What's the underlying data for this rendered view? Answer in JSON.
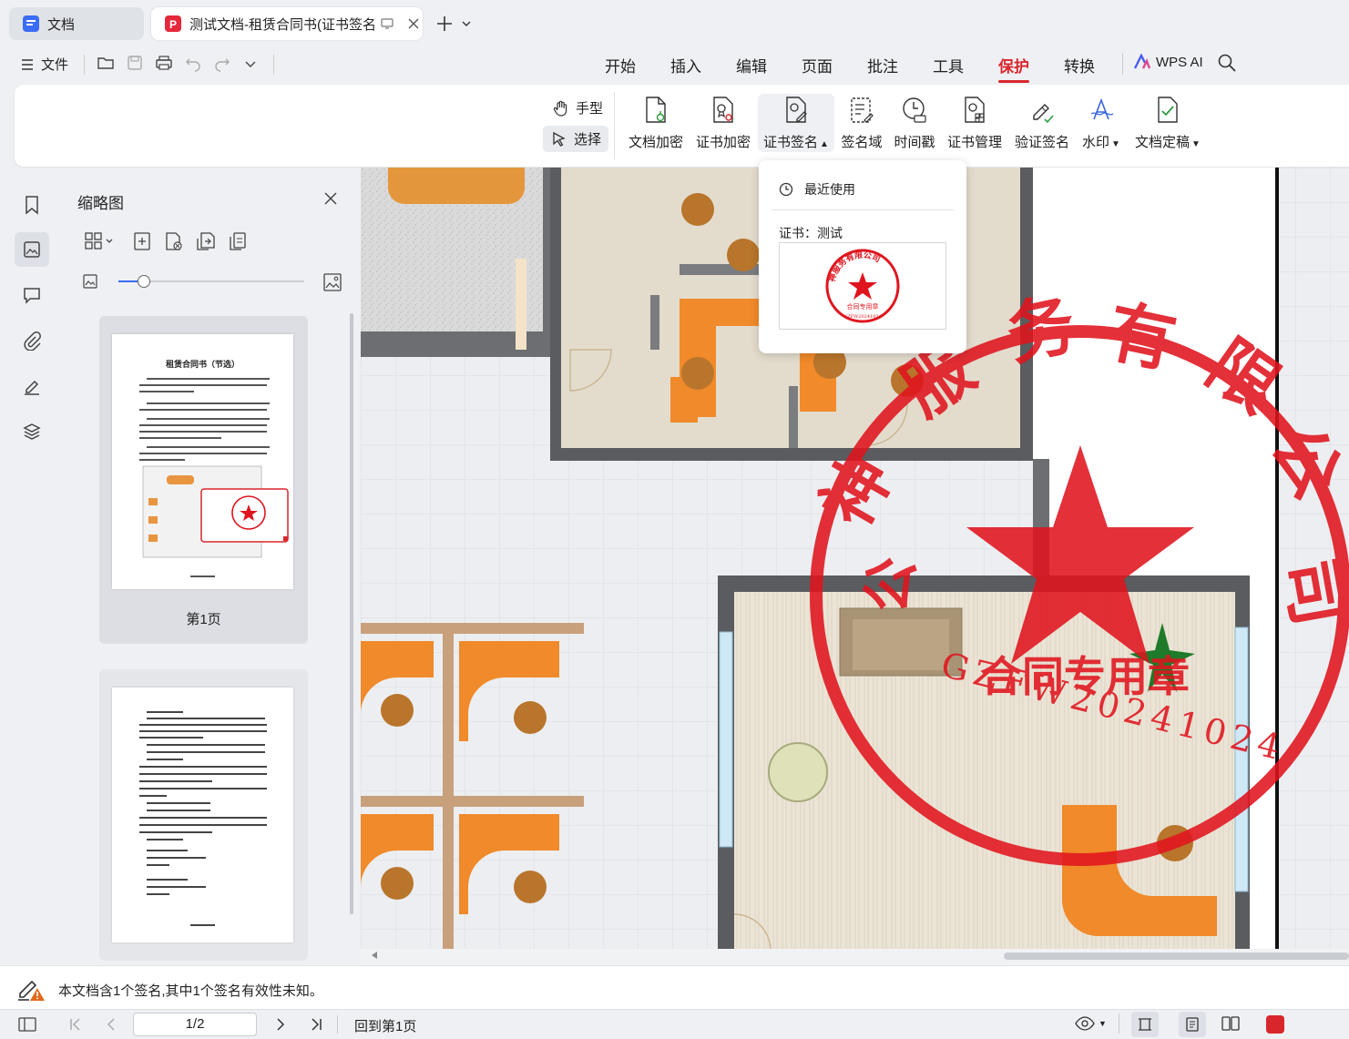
{
  "tabs": {
    "docs_label": "文档",
    "active_label": "测试文档-租赁合同书(证书签名).pdf"
  },
  "menu": {
    "file_label": "文件",
    "tabs": [
      "开始",
      "插入",
      "编辑",
      "页面",
      "批注",
      "工具",
      "保护",
      "转换"
    ],
    "active_tab": "保护",
    "wps_ai_label": "WPS AI"
  },
  "ribbon": {
    "hand_label": "手型",
    "select_label": "选择",
    "doc_encrypt": "文档加密",
    "cert_encrypt": "证书加密",
    "cert_sign": "证书签名",
    "sign_field": "签名域",
    "timestamp": "时间戳",
    "cert_manage": "证书管理",
    "verify_sign": "验证签名",
    "watermark": "水印",
    "finalize": "文档定稿"
  },
  "dropdown": {
    "recent_label": "最近使用",
    "cert_label": "证书：测试"
  },
  "stamp": {
    "company_text": "神服务有限公司",
    "center_text": "合同专用章",
    "serial": "GZFW20241024"
  },
  "thumbnails": {
    "title": "缩略图",
    "page1_label": "第1页",
    "page1_title": "租赁合同书（节选）"
  },
  "status": {
    "signature_message": "本文档含1个签名,其中1个签名有效性未知。"
  },
  "bottom": {
    "page_indicator": "1/2",
    "back_to_first": "回到第1页"
  },
  "colors": {
    "accent": "#d9262c",
    "stamp_red": "#e0141e",
    "wood": "#f08a2a"
  }
}
